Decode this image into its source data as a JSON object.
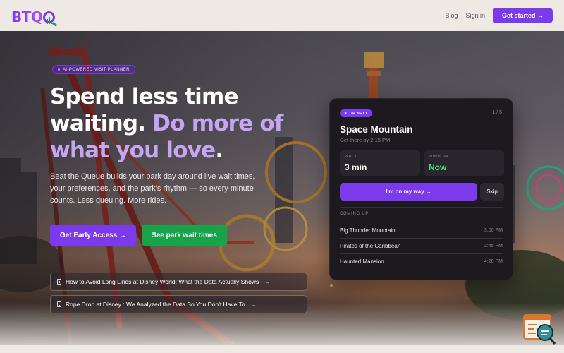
{
  "header": {
    "logo_text": "BTQ",
    "nav": [
      "Blog",
      "Sign in"
    ],
    "cta": "Get started →"
  },
  "hero": {
    "badge": "AI-POWERED VISIT PLANNER",
    "headline_line1": "Spend less time",
    "headline_line2_white": "waiting.",
    "headline_line2_accent": "Do more of",
    "headline_line3_accent": "what you love",
    "headline_line3_end": ".",
    "subcopy": "Beat the Queue builds your park day around live wait times, your preferences, and the park's rhythm — so every minute counts. Less queuing. More rides.",
    "primary_cta": "Get Early Access →",
    "secondary_cta": "See park wait times",
    "articles": [
      "How to Avoid Long Lines at Disney World: What the Data Actually Shows",
      "Rope Drop at Disney : We Analyzed the Data So You Don't Have To"
    ],
    "article_arrow": "→"
  },
  "card": {
    "badge": "UP NEXT",
    "counter": "1 / 5",
    "ride": "Space Mountain",
    "subtitle": "Get there by 2:15 PM",
    "walk_label": "WALK",
    "walk_value": "3 min",
    "window_label": "WINDOW",
    "window_value": "Now",
    "go_button": "I'm on my way →",
    "skip_button": "Skip",
    "coming_up_label": "COMING UP",
    "coming_up": [
      {
        "name": "Big Thunder Mountain",
        "time": "3:00 PM"
      },
      {
        "name": "Pirates of the Caribbean",
        "time": "3:45 PM"
      },
      {
        "name": "Haunted Mansion",
        "time": "4:20 PM"
      }
    ]
  },
  "colors": {
    "brand": "#7c3aed",
    "accent_text": "#c4a6f5",
    "green": "#16a34a",
    "now_green": "#4ade80",
    "card_bg": "#1c1a1f"
  },
  "icons": [
    "document-icon",
    "star-icon",
    "arrow-right-icon",
    "chat-widget-icon"
  ]
}
